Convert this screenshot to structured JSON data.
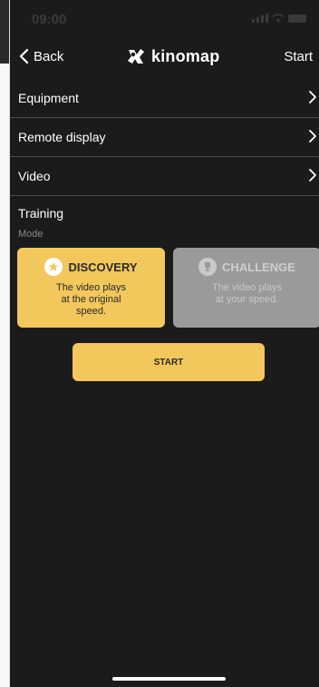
{
  "status_bar": {
    "time": "09:00"
  },
  "nav": {
    "back_label": "Back",
    "logo_text": "kinomap",
    "start_label": "Start"
  },
  "menu": [
    {
      "label": "Equipment"
    },
    {
      "label": "Remote display"
    },
    {
      "label": "Video"
    }
  ],
  "training": {
    "title": "Training",
    "subtitle": "Mode"
  },
  "modes": {
    "discovery": {
      "title": "DISCOVERY",
      "desc_line1": "The video plays",
      "desc_line2": "at the original",
      "desc_line3": "speed.",
      "selected": true,
      "icon": "star-icon"
    },
    "challenge": {
      "title": "CHALLENGE",
      "desc_line1": "The video plays",
      "desc_line2": "at your speed.",
      "selected": false,
      "icon": "trophy-icon"
    }
  },
  "start_button": {
    "label": "START"
  },
  "colors": {
    "background": "#1b1b1b",
    "accent": "#f2c75c",
    "disabled": "#9a9a9a"
  }
}
